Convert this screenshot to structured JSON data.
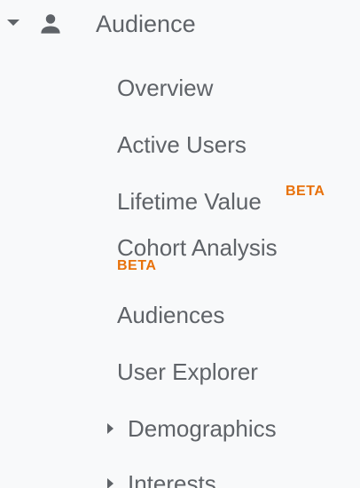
{
  "section": {
    "title": "Audience",
    "icon": "person-icon",
    "expand_icon": "caret-down-icon"
  },
  "items": [
    {
      "label": "Overview"
    },
    {
      "label": "Active Users"
    },
    {
      "label": "Lifetime Value",
      "badge": "BETA"
    },
    {
      "label": "Cohort Analysis",
      "badge": "BETA"
    },
    {
      "label": "Audiences"
    },
    {
      "label": "User Explorer"
    }
  ],
  "expandables": [
    {
      "label": "Demographics",
      "icon": "caret-right-icon"
    },
    {
      "label": "Interests",
      "icon": "caret-right-icon"
    }
  ],
  "colors": {
    "text": "#5f6368",
    "badge": "#e8710a",
    "background": "#f8f9fa"
  }
}
